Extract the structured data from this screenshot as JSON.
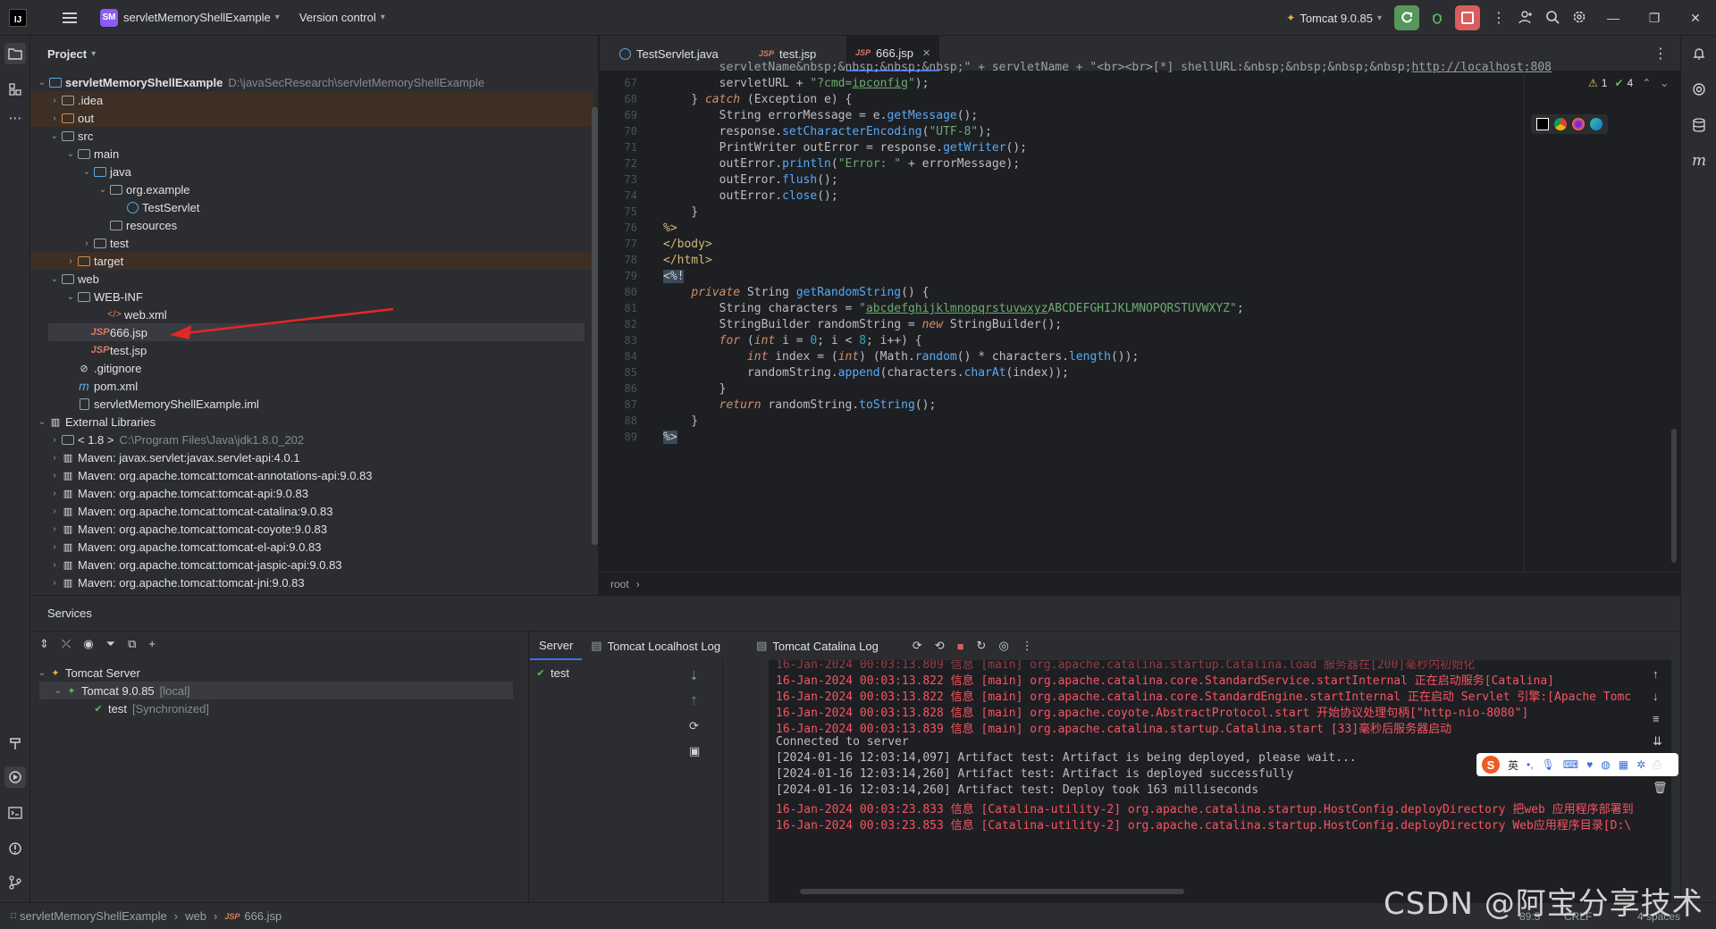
{
  "titlebar": {
    "project_badge": "SM",
    "project_name": "servletMemoryShellExample",
    "vcs": "Version control",
    "run_config": "Tomcat 9.0.85"
  },
  "project_panel": {
    "title": "Project",
    "rows": [
      {
        "label": "servletMemoryShellExample",
        "extra": "D:\\javaSecResearch\\servletMemoryShellExample"
      },
      {
        "label": ".idea"
      },
      {
        "label": "out"
      },
      {
        "label": "src"
      },
      {
        "label": "main"
      },
      {
        "label": "java"
      },
      {
        "label": "org.example"
      },
      {
        "label": "TestServlet"
      },
      {
        "label": "resources"
      },
      {
        "label": "test"
      },
      {
        "label": "target"
      },
      {
        "label": "web"
      },
      {
        "label": "WEB-INF"
      },
      {
        "label": "web.xml"
      },
      {
        "label": "666.jsp"
      },
      {
        "label": "test.jsp"
      },
      {
        "label": ".gitignore"
      },
      {
        "label": "pom.xml"
      },
      {
        "label": "servletMemoryShellExample.iml"
      },
      {
        "label": "External Libraries"
      },
      {
        "label": "< 1.8 >",
        "extra": "C:\\Program Files\\Java\\jdk1.8.0_202"
      },
      {
        "label": "Maven: javax.servlet:javax.servlet-api:4.0.1"
      },
      {
        "label": "Maven: org.apache.tomcat:tomcat-annotations-api:9.0.83"
      },
      {
        "label": "Maven: org.apache.tomcat:tomcat-api:9.0.83"
      },
      {
        "label": "Maven: org.apache.tomcat:tomcat-catalina:9.0.83"
      },
      {
        "label": "Maven: org.apache.tomcat:tomcat-coyote:9.0.83"
      },
      {
        "label": "Maven: org.apache.tomcat:tomcat-el-api:9.0.83"
      },
      {
        "label": "Maven: org.apache.tomcat:tomcat-jaspic-api:9.0.83"
      },
      {
        "label": "Maven: org.apache.tomcat:tomcat-jni:9.0.83"
      }
    ]
  },
  "editor": {
    "tabs": [
      {
        "label": "TestServlet.java"
      },
      {
        "label": "test.jsp"
      },
      {
        "label": "666.jsp"
      }
    ],
    "inspection": {
      "warnings": "1",
      "ok": "4"
    },
    "line_numbers": [
      "67",
      "68",
      "69",
      "70",
      "71",
      "72",
      "73",
      "74",
      "75",
      "76",
      "77",
      "78",
      "79",
      "80",
      "81",
      "82",
      "83",
      "84",
      "85",
      "86",
      "87",
      "88",
      "89"
    ],
    "breadcrumb": "root"
  },
  "services": {
    "title": "Services",
    "tree": [
      {
        "label": "Tomcat Server"
      },
      {
        "label": "Tomcat 9.0.85",
        "extra": "[local]"
      },
      {
        "label": "test",
        "extra": "[Synchronized]"
      }
    ],
    "tabs": [
      {
        "label": "Server"
      },
      {
        "label": "Tomcat Localhost Log"
      },
      {
        "label": "Tomcat Catalina Log"
      }
    ],
    "deployment": "test",
    "console": [
      {
        "text": "16-Jan-2024 00:03:13.822 信息 [main] org.apache.catalina.core.StandardService.startInternal 正在启动服务[Catalina]",
        "style": "red"
      },
      {
        "text": "16-Jan-2024 00:03:13.822 信息 [main] org.apache.catalina.core.StandardEngine.startInternal 正在启动 Servlet 引擎:[Apache Tomc",
        "style": "red"
      },
      {
        "text": "16-Jan-2024 00:03:13.828 信息 [main] org.apache.coyote.AbstractProtocol.start 开始协议处理句柄[\"http-nio-8080\"]",
        "style": "red"
      },
      {
        "text": "16-Jan-2024 00:03:13.839 信息 [main] org.apache.catalina.startup.Catalina.start [33]毫秒后服务器启动",
        "style": "red"
      },
      {
        "text": "Connected to server",
        "style": "norm"
      },
      {
        "text": "[2024-01-16 12:03:14,097] Artifact test: Artifact is being deployed, please wait...",
        "style": "norm"
      },
      {
        "text": "[2024-01-16 12:03:14,260] Artifact test: Artifact is deployed successfully",
        "style": "norm"
      },
      {
        "text": "[2024-01-16 12:03:14,260] Artifact test: Deploy took 163 milliseconds",
        "style": "norm"
      },
      {
        "text": "16-Jan-2024 00:03:23.833 信息 [Catalina-utility-2] org.apache.catalina.startup.HostConfig.deployDirectory 把web 应用程序部署到",
        "style": "red"
      },
      {
        "text": "16-Jan-2024 00:03:23.853 信息 [Catalina-utility-2] org.apache.catalina.startup.HostConfig.deployDirectory Web应用程序目录[D:\\",
        "style": "red"
      }
    ],
    "ime_label": "英"
  },
  "statusbar": {
    "crumbs": [
      "servletMemoryShellExample",
      "web",
      "666.jsp"
    ],
    "position": "89:3",
    "line_sep": "CRLF",
    "indent": "4 spaces"
  },
  "watermark": "CSDN @阿宝分享技术"
}
